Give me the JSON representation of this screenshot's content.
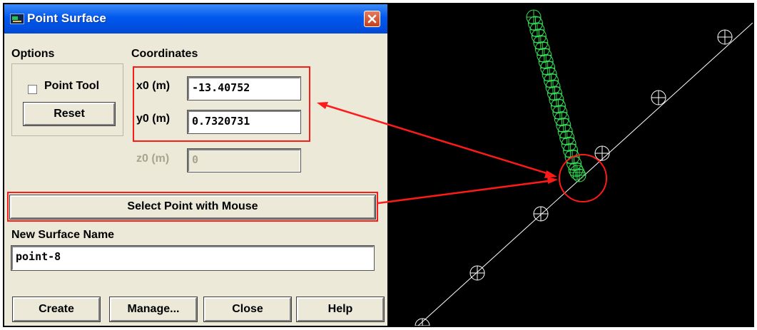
{
  "dialog": {
    "title": "Point Surface",
    "options": {
      "header": "Options",
      "point_tool_label": "Point Tool",
      "point_tool_checked": false,
      "reset_label": "Reset"
    },
    "coordinates": {
      "header": "Coordinates",
      "x0_label": "x0 (m)",
      "x0_value": "-13.40752",
      "y0_label": "y0 (m)",
      "y0_value": "0.7320731",
      "z0_label": "z0 (m)",
      "z0_value": "0",
      "z0_enabled": false
    },
    "select_point_label": "Select Point with Mouse",
    "surface_name": {
      "label": "New Surface Name",
      "value": "point-8"
    },
    "buttons": {
      "create": "Create",
      "manage": "Manage...",
      "close": "Close",
      "help": "Help"
    }
  },
  "graphics": {
    "background": "#000000",
    "line_color": "#ffffff",
    "cluster_color": "#33dd55",
    "annotation_color": "#ff1a1a"
  }
}
